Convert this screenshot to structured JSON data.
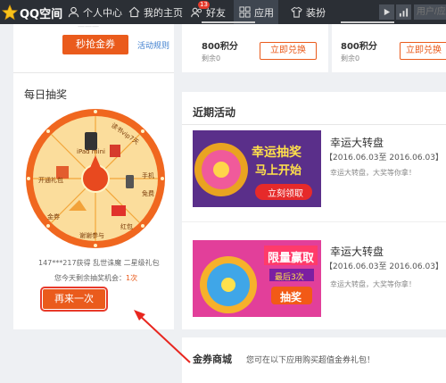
{
  "topbar": {
    "logo_text": "QQ空间",
    "nav": [
      {
        "label": "个人中心"
      },
      {
        "label": "我的主页"
      },
      {
        "label": "好友",
        "badge": "13"
      },
      {
        "label": "应用"
      },
      {
        "label": "装扮"
      }
    ],
    "search_placeholder": "用户/应用"
  },
  "left": {
    "seckill_button": "秒抢金券",
    "rules_link": "活动规则",
    "daily_title": "每日抽奖",
    "wheel_labels": [
      "iPad mini",
      "读书vip7天",
      "手机",
      "免费",
      "红包",
      "开通礼包",
      "谢谢参与",
      "金券"
    ],
    "winner_text": "147***217获得 乱世诛魔 二星级礼包",
    "chances_prefix": "您今天剩余抽奖机会：",
    "chances_value": "1次",
    "again_button": "再来一次"
  },
  "offers": [
    {
      "points": "800积分",
      "stock": "剩余0",
      "button": "立即兑换"
    },
    {
      "points": "800积分",
      "stock": "剩余0",
      "button": "立即兑换"
    }
  ],
  "recent": {
    "title": "近期活动",
    "items": [
      {
        "title": "幸运大转盘",
        "date": "【2016.06.03至 2016.06.03】",
        "desc": "幸运大转盘，大奖等你拿！",
        "banner_text1": "幸运抽奖",
        "banner_text2": "马上开始",
        "banner_button": "立刻领取"
      },
      {
        "title": "幸运大转盘",
        "date": "【2016.06.03至 2016.06.03】",
        "desc": "幸运大转盘，大奖等你拿！",
        "banner_text1": "限量赢取",
        "banner_text2": "最后3次",
        "banner_button": "抽奖"
      }
    ]
  },
  "mall": {
    "title": "金券商城",
    "desc": "您可在以下应用购买超值金券礼包！"
  },
  "colors": {
    "topbar": "#2b2f35",
    "accent": "#ea5b1c",
    "link": "#3f7fcf",
    "background": "#eef0f3"
  }
}
